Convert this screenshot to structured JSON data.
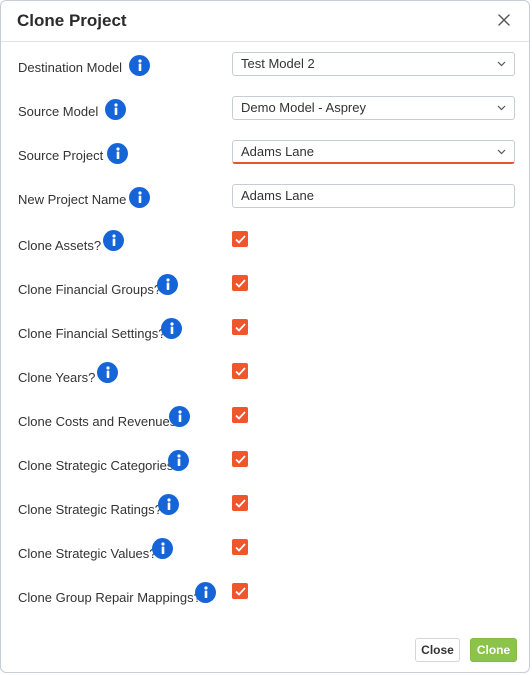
{
  "dialog": {
    "title": "Clone Project",
    "close_icon": "close-icon"
  },
  "fields": {
    "destination_model": {
      "label": "Destination Model",
      "value": "Test Model 2"
    },
    "source_model": {
      "label": "Source Model",
      "value": "Demo Model - Asprey"
    },
    "source_project": {
      "label": "Source Project",
      "value": "Adams Lane"
    },
    "new_project_name": {
      "label": "New Project Name",
      "value": "Adams Lane"
    }
  },
  "options": {
    "clone_assets": {
      "label": "Clone Assets?",
      "checked": true
    },
    "clone_financial_groups": {
      "label": "Clone Financial Groups?",
      "checked": true
    },
    "clone_financial_settings": {
      "label": "Clone Financial Settings?",
      "checked": true
    },
    "clone_years": {
      "label": "Clone Years?",
      "checked": true
    },
    "clone_costs_revenues": {
      "label": "Clone Costs and Revenues",
      "checked": true
    },
    "clone_strategic_categories": {
      "label": "Clone Strategic Categories?",
      "checked": true
    },
    "clone_strategic_ratings": {
      "label": "Clone Strategic Ratings?",
      "checked": true
    },
    "clone_strategic_values": {
      "label": "Clone Strategic Values?",
      "checked": true
    },
    "clone_group_repair_mappings": {
      "label": "Clone Group Repair Mappings?",
      "checked": true
    }
  },
  "footer": {
    "close_label": "Close",
    "clone_label": "Clone"
  },
  "colors": {
    "info_blue": "#1565d8",
    "checkbox_orange": "#f0562c",
    "clone_green": "#8cc34a",
    "active_underline": "#e2572f"
  },
  "icons": {
    "info": "info-icon",
    "dropdown": "chevron-down-icon",
    "check": "check-icon"
  }
}
